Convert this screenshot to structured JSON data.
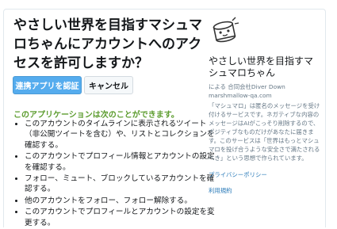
{
  "dialog": {
    "title": "やさしい世界を目指すマシュマロちゃんにアカウントへのアクセスを許可しますか？",
    "authorize_label": "連携アプリを認証",
    "cancel_label": "キャンセル",
    "permissions_heading": "このアプリケーションは次のことができます。",
    "permissions": [
      "このアカウントのタイムラインに表示されるツイート（非公開ツイートを含む）や、リストとコレクションを確認する。",
      "このアカウントでプロフィール情報とアカウントの設定を確認する。",
      "フォロー、ミュート、ブロックしているアカウントを確認する。",
      "他のアカウントをフォロー、フォロー解除する。",
      "このアカウントでプロフィールとアカウントの設定を変更する。"
    ]
  },
  "app": {
    "icon": "marshmallow-mascot-icon",
    "name": "やさしい世界を目指すマシュマロちゃん",
    "by_line": "による 合同会社Diver Down",
    "url": "marshmallow-qa.com",
    "description": "「マシュマロ」は匿名のメッセージを受け付けるサービスです。ネガティブな内容のメッセージはAIがこっそり削除するので、ポジティブなものだけがあなたに届きます。このサービスは「世界はもっとマシュマロを投げ合うような安全さで満たされるべき」という思想で作られています。",
    "privacy_link": "プライバシーポリシー",
    "terms_link": "利用規約"
  },
  "colors": {
    "authorize_bg": "#55acee",
    "permissions_heading": "#5c9c2e",
    "link": "#2b7bb9"
  }
}
